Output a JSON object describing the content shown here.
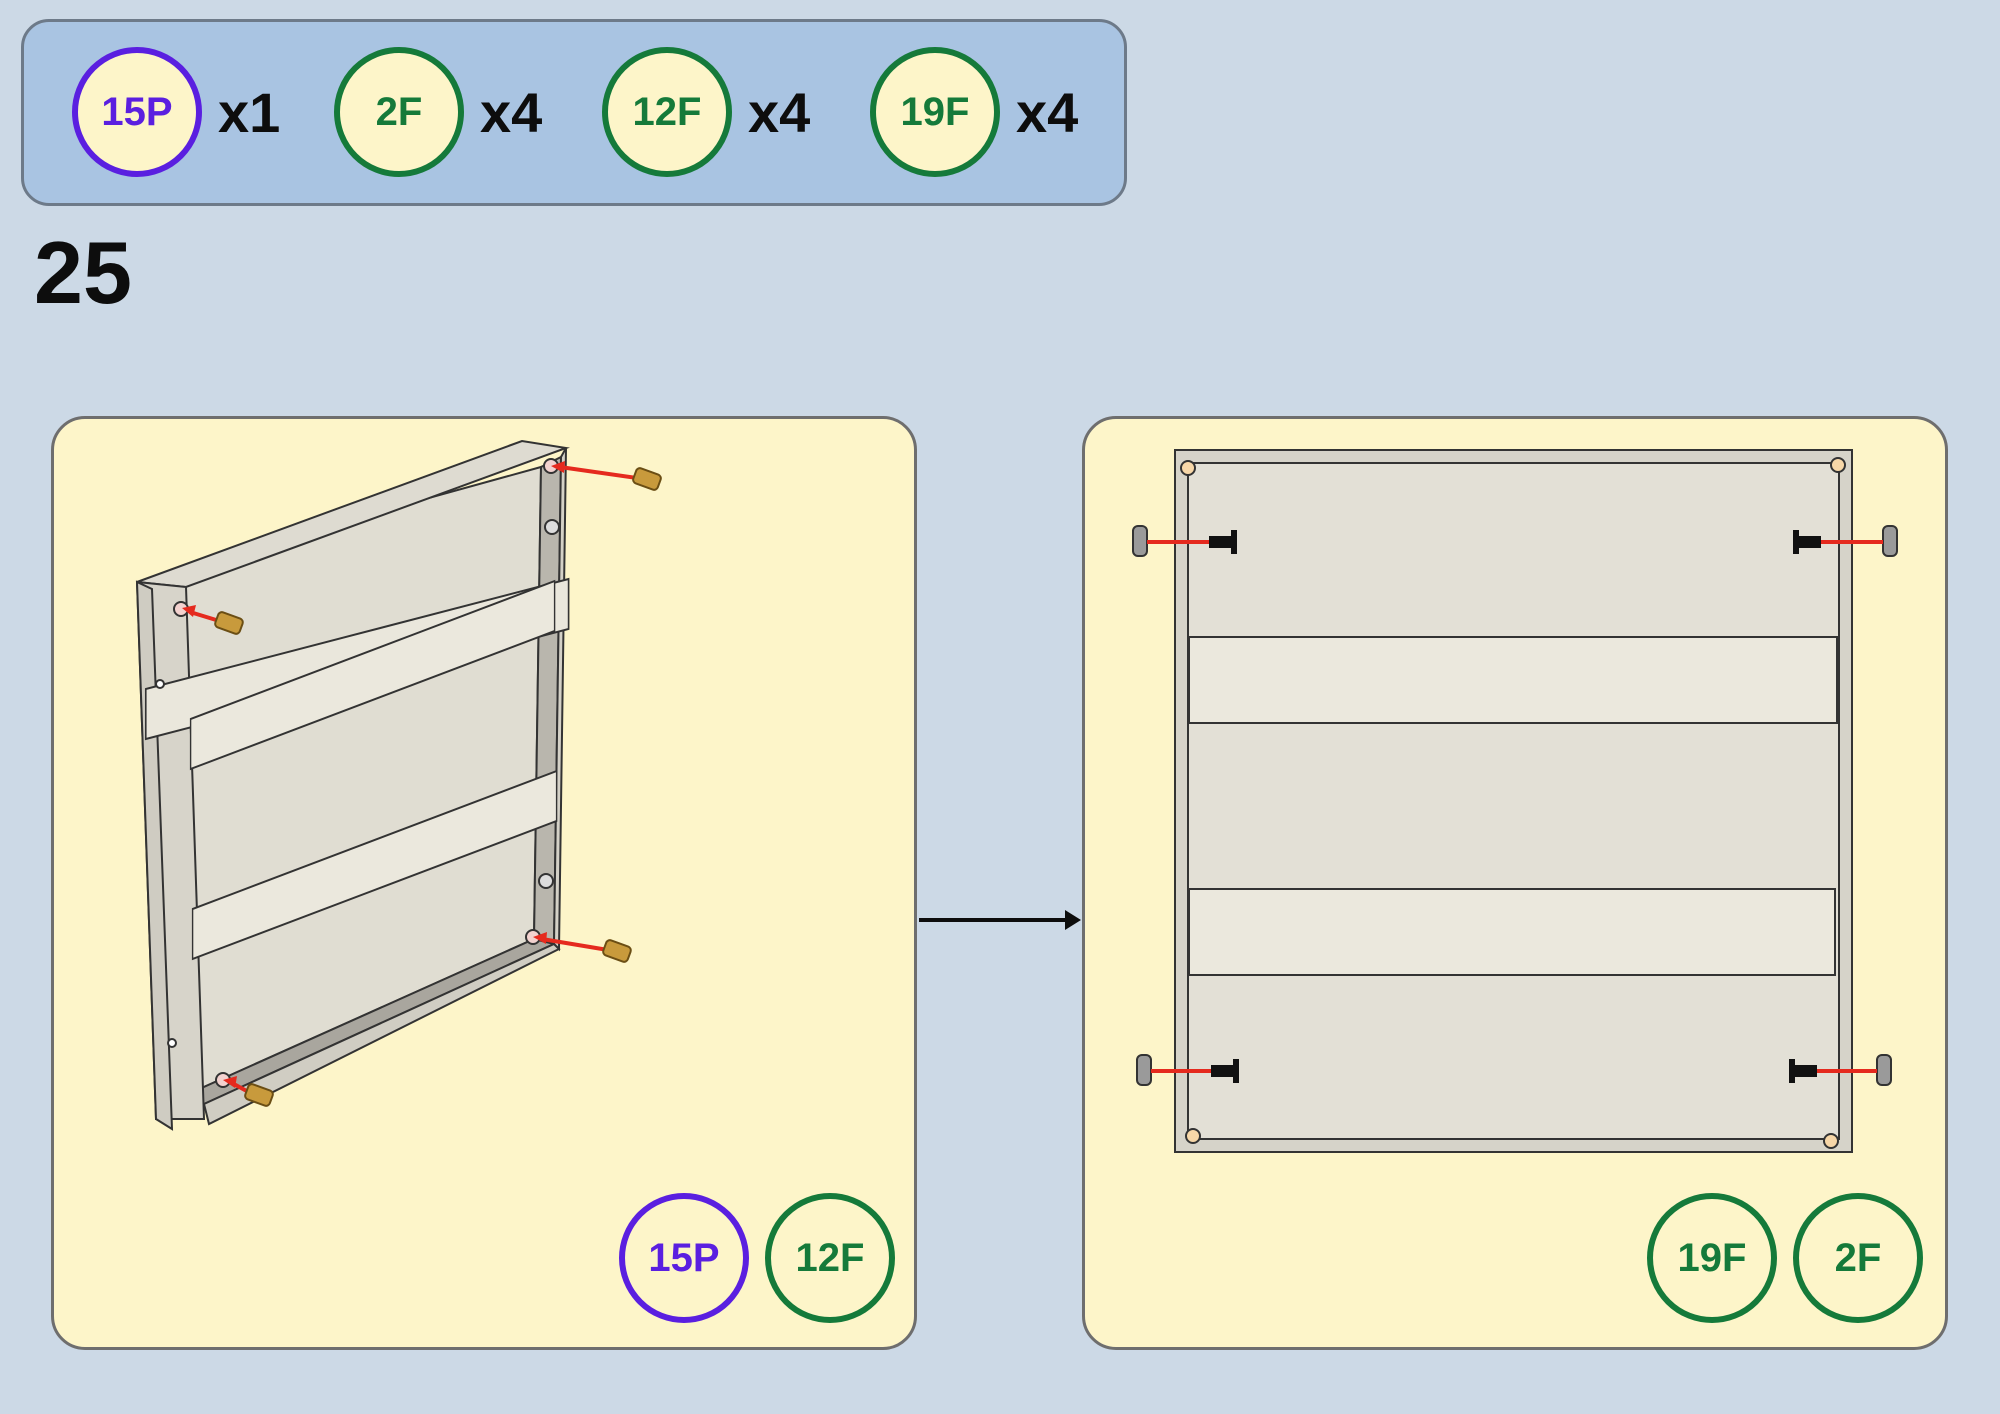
{
  "step": {
    "number": "25"
  },
  "parts": [
    {
      "label": "15P",
      "qty": "x1",
      "color": "#5a1fe0"
    },
    {
      "label": "2F",
      "qty": "x4",
      "color": "#157a3a"
    },
    {
      "label": "12F",
      "qty": "x4",
      "color": "#157a3a"
    },
    {
      "label": "19F",
      "qty": "x4",
      "color": "#157a3a"
    }
  ],
  "panels": [
    {
      "badges": [
        "15P",
        "12F"
      ]
    },
    {
      "badges": [
        "19F",
        "2F"
      ]
    }
  ],
  "colors": {
    "background": "#ccd9e6",
    "parts_bar": "#a9c4e2",
    "panel_bg": "#fdf5c9",
    "purple_part": "#5a1fe0",
    "green_part": "#157a3a",
    "insert_arrow": "#e52a1e"
  },
  "icons": [
    "brass-threaded-insert-icon",
    "bolt-icon",
    "cap-icon",
    "flow-arrow-icon"
  ]
}
